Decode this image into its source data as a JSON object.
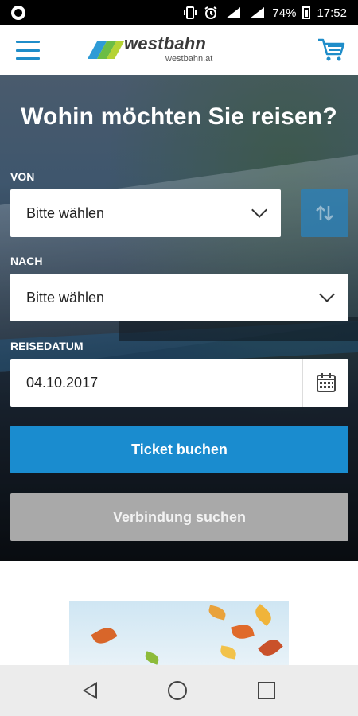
{
  "status_bar": {
    "battery_percent": "74%",
    "time": "17:52",
    "icons": [
      "vibrate-icon",
      "alarm-icon",
      "signal-icon",
      "signal-icon",
      "battery-icon"
    ]
  },
  "header": {
    "menu_icon": "hamburger-menu-icon",
    "logo_text": "westbahn",
    "logo_sub": "westbahn.at",
    "cart_icon": "shopping-cart-icon"
  },
  "search": {
    "title": "Wohin möchten Sie reisen?",
    "from_label": "VON",
    "from_value": "Bitte wählen",
    "to_label": "NACH",
    "to_value": "Bitte wählen",
    "date_label": "REISEDATUM",
    "date_value": "04.10.2017",
    "swap_icon": "swap-arrows-icon",
    "calendar_icon": "calendar-icon",
    "book_button": "Ticket buchen",
    "search_button": "Verbindung suchen"
  },
  "colors": {
    "brand_blue": "#1a8ccf",
    "disabled_gray": "#a9a9a9",
    "logo_green": "#8cc63f"
  },
  "nav": {
    "back_icon": "back-triangle-icon",
    "home_icon": "home-circle-icon",
    "recents_icon": "recents-square-icon"
  }
}
